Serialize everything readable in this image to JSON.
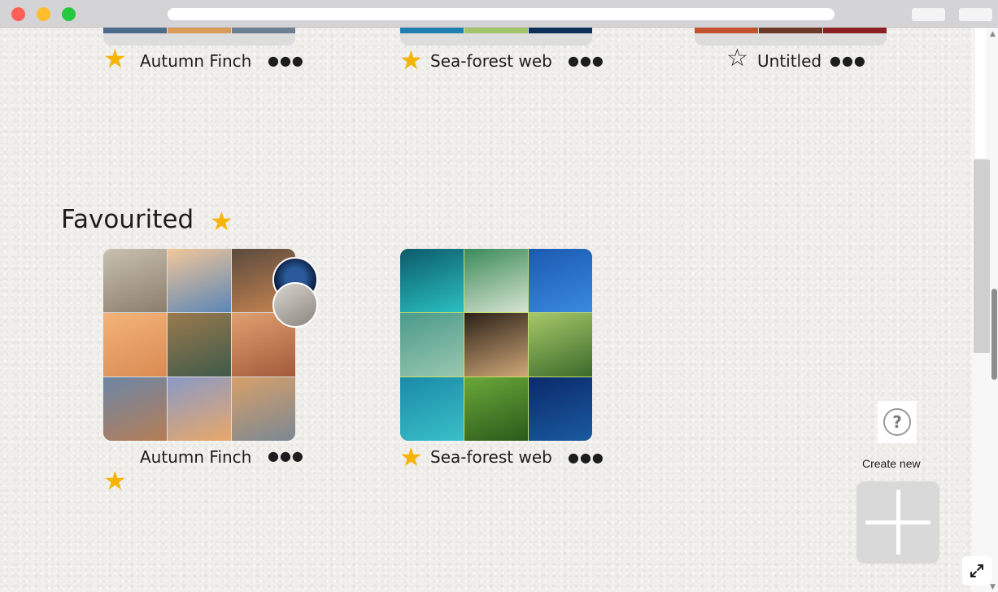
{
  "window": {
    "colors": {
      "close": "#fe5f57",
      "minimize": "#febc2e",
      "zoom": "#28c840"
    }
  },
  "top_row": [
    {
      "title": "Autumn Finch",
      "starred": true,
      "tiles": [
        "#4c6a8a",
        "#d99a5a",
        "#6f7f92"
      ]
    },
    {
      "title": "Sea-forest web",
      "starred": true,
      "tiles": [
        "#1e7fb0",
        "#a4c46a",
        "#0d2f5a"
      ]
    },
    {
      "title": "Untitled",
      "starred": false,
      "tiles": [
        "#c2532e",
        "#6b3a2a",
        "#8a1f24"
      ]
    }
  ],
  "favourited": {
    "heading": "Favourited",
    "boards": [
      {
        "title": "Autumn Finch",
        "starred": true,
        "tiles": [
          "#b7b0a4",
          "#e9b07c",
          "#a8613a",
          "#e9a364",
          "#8a6a48",
          "#c87a4a",
          "#7d8da0",
          "#c78a66",
          "#c89464"
        ]
      },
      {
        "title": "Sea-forest web",
        "starred": true,
        "tiles": [
          "#1a8a9a",
          "#9cc4c8",
          "#1f6fc0",
          "#6fa6a0",
          "#5a4a3a",
          "#7aa85a",
          "#2aa0b8",
          "#6a9a3a",
          "#0b3a78"
        ]
      }
    ]
  },
  "help": {
    "icon": "question-mark-icon",
    "symbol": "?"
  },
  "create": {
    "label": "Create new",
    "icon": "plus-icon"
  },
  "expand": {
    "icon": "expand-icon"
  },
  "accent": {
    "star": "#f4b400"
  }
}
